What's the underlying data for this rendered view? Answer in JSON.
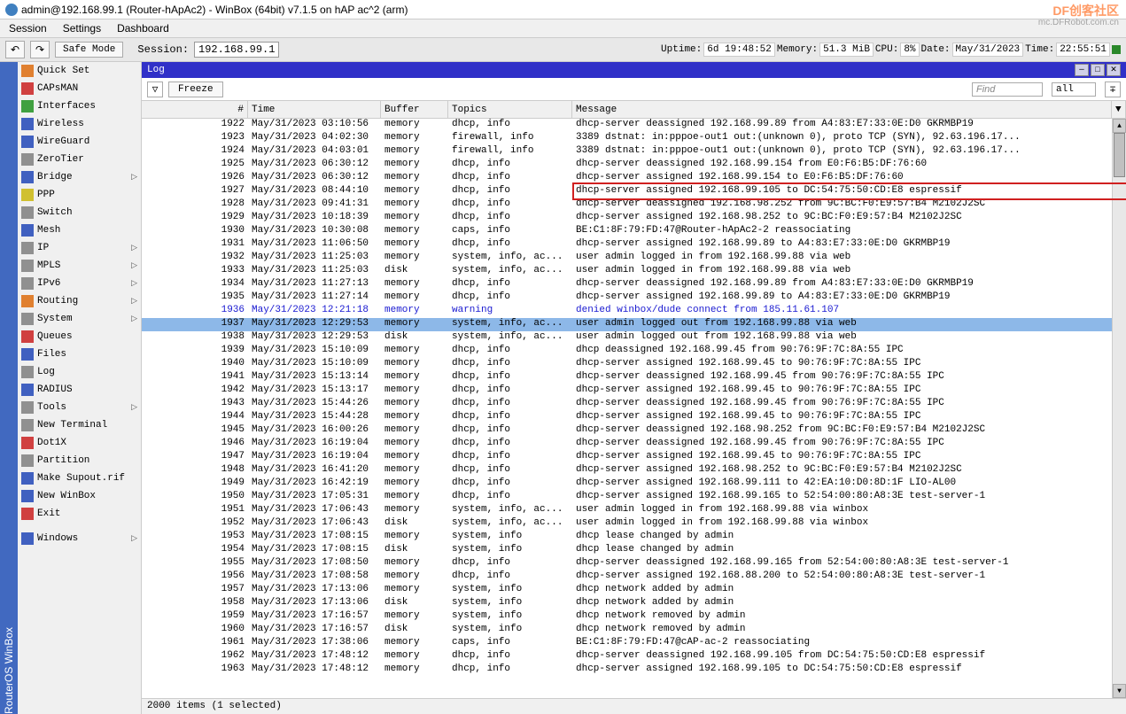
{
  "title": "admin@192.168.99.1 (Router-hApAc2) - WinBox (64bit) v7.1.5 on hAP ac^2 (arm)",
  "watermark": "DF创客社区",
  "watermark_url": "mc.DFRobot.com.cn",
  "menu": {
    "session": "Session",
    "settings": "Settings",
    "dashboard": "Dashboard"
  },
  "toolbar": {
    "safe_mode": "Safe Mode",
    "session_label": "Session:",
    "session_ip": "192.168.99.1"
  },
  "status": {
    "uptime_label": "Uptime:",
    "uptime": "6d 19:48:52",
    "memory_label": "Memory:",
    "memory": "51.3 MiB",
    "cpu_label": "CPU:",
    "cpu": "8%",
    "date_label": "Date:",
    "date": "May/31/2023",
    "time_label": "Time:",
    "time": "22:55:51"
  },
  "vertical_tab": "RouterOS WinBox",
  "sidebar": [
    {
      "label": "Quick Set",
      "ic": "ic-org"
    },
    {
      "label": "CAPsMAN",
      "ic": "ic-red"
    },
    {
      "label": "Interfaces",
      "ic": "ic-grn"
    },
    {
      "label": "Wireless",
      "ic": "ic-blu"
    },
    {
      "label": "WireGuard",
      "ic": "ic-blu"
    },
    {
      "label": "ZeroTier",
      "ic": "ic-gry"
    },
    {
      "label": "Bridge",
      "ic": "ic-blu",
      "arrow": true
    },
    {
      "label": "PPP",
      "ic": "ic-ylw"
    },
    {
      "label": "Switch",
      "ic": "ic-gry"
    },
    {
      "label": "Mesh",
      "ic": "ic-blu"
    },
    {
      "label": "IP",
      "ic": "ic-gry",
      "arrow": true
    },
    {
      "label": "MPLS",
      "ic": "ic-gry",
      "arrow": true
    },
    {
      "label": "IPv6",
      "ic": "ic-gry",
      "arrow": true
    },
    {
      "label": "Routing",
      "ic": "ic-org",
      "arrow": true
    },
    {
      "label": "System",
      "ic": "ic-gry",
      "arrow": true
    },
    {
      "label": "Queues",
      "ic": "ic-red"
    },
    {
      "label": "Files",
      "ic": "ic-blu"
    },
    {
      "label": "Log",
      "ic": "ic-gry"
    },
    {
      "label": "RADIUS",
      "ic": "ic-blu"
    },
    {
      "label": "Tools",
      "ic": "ic-gry",
      "arrow": true
    },
    {
      "label": "New Terminal",
      "ic": "ic-gry"
    },
    {
      "label": "Dot1X",
      "ic": "ic-red"
    },
    {
      "label": "Partition",
      "ic": "ic-gry"
    },
    {
      "label": "Make Supout.rif",
      "ic": "ic-blu"
    },
    {
      "label": "New WinBox",
      "ic": "ic-blu"
    },
    {
      "label": "Exit",
      "ic": "ic-red"
    },
    {
      "label": "Windows",
      "ic": "ic-blu",
      "arrow": true,
      "sep": true
    }
  ],
  "log": {
    "title": "Log",
    "freeze": "Freeze",
    "find_placeholder": "Find",
    "filter_all": "all",
    "columns": {
      "num": "#",
      "time": "Time",
      "buffer": "Buffer",
      "topics": "Topics",
      "message": "Message"
    },
    "status_bar": "2000 items (1 selected)",
    "highlighted_row_index": 5,
    "selected_row_index": 15,
    "rows": [
      {
        "n": 1922,
        "t": "May/31/2023 03:10:56",
        "b": "memory",
        "tp": "dhcp, info",
        "m": "dhcp-server deassigned 192.168.99.89 from A4:83:E7:33:0E:D0 GKRMBP19"
      },
      {
        "n": 1923,
        "t": "May/31/2023 04:02:30",
        "b": "memory",
        "tp": "firewall, info",
        "m": "3389 dstnat: in:pppoe-out1 out:(unknown 0), proto TCP (SYN), 92.63.196.17..."
      },
      {
        "n": 1924,
        "t": "May/31/2023 04:03:01",
        "b": "memory",
        "tp": "firewall, info",
        "m": "3389 dstnat: in:pppoe-out1 out:(unknown 0), proto TCP (SYN), 92.63.196.17..."
      },
      {
        "n": 1925,
        "t": "May/31/2023 06:30:12",
        "b": "memory",
        "tp": "dhcp, info",
        "m": "dhcp-server deassigned 192.168.99.154 from E0:F6:B5:DF:76:60"
      },
      {
        "n": 1926,
        "t": "May/31/2023 06:30:12",
        "b": "memory",
        "tp": "dhcp, info",
        "m": "dhcp-server assigned 192.168.99.154 to E0:F6:B5:DF:76:60"
      },
      {
        "n": 1927,
        "t": "May/31/2023 08:44:10",
        "b": "memory",
        "tp": "dhcp, info",
        "m": "dhcp-server assigned 192.168.99.105 to DC:54:75:50:CD:E8 espressif"
      },
      {
        "n": 1928,
        "t": "May/31/2023 09:41:31",
        "b": "memory",
        "tp": "dhcp, info",
        "m": "dhcp-server deassigned 192.168.98.252 from 9C:BC:F0:E9:57:B4 M2102J2SC"
      },
      {
        "n": 1929,
        "t": "May/31/2023 10:18:39",
        "b": "memory",
        "tp": "dhcp, info",
        "m": "dhcp-server assigned 192.168.98.252 to 9C:BC:F0:E9:57:B4 M2102J2SC"
      },
      {
        "n": 1930,
        "t": "May/31/2023 10:30:08",
        "b": "memory",
        "tp": "caps, info",
        "m": "BE:C1:8F:79:FD:47@Router-hApAc2-2 reassociating"
      },
      {
        "n": 1931,
        "t": "May/31/2023 11:06:50",
        "b": "memory",
        "tp": "dhcp, info",
        "m": "dhcp-server assigned 192.168.99.89 to A4:83:E7:33:0E:D0 GKRMBP19"
      },
      {
        "n": 1932,
        "t": "May/31/2023 11:25:03",
        "b": "memory",
        "tp": "system, info, ac...",
        "m": "user admin logged in from 192.168.99.88 via web"
      },
      {
        "n": 1933,
        "t": "May/31/2023 11:25:03",
        "b": "disk",
        "tp": "system, info, ac...",
        "m": "user admin logged in from 192.168.99.88 via web"
      },
      {
        "n": 1934,
        "t": "May/31/2023 11:27:13",
        "b": "memory",
        "tp": "dhcp, info",
        "m": "dhcp-server deassigned 192.168.99.89 from A4:83:E7:33:0E:D0 GKRMBP19"
      },
      {
        "n": 1935,
        "t": "May/31/2023 11:27:14",
        "b": "memory",
        "tp": "dhcp, info",
        "m": "dhcp-server assigned 192.168.99.89 to A4:83:E7:33:0E:D0 GKRMBP19"
      },
      {
        "n": 1936,
        "t": "May/31/2023 12:21:18",
        "b": "memory",
        "tp": "warning",
        "m": "denied winbox/dude connect from 185.11.61.107",
        "blue": true
      },
      {
        "n": 1937,
        "t": "May/31/2023 12:29:53",
        "b": "memory",
        "tp": "system, info, ac...",
        "m": "user admin logged out from 192.168.99.88 via web"
      },
      {
        "n": 1938,
        "t": "May/31/2023 12:29:53",
        "b": "disk",
        "tp": "system, info, ac...",
        "m": "user admin logged out from 192.168.99.88 via web"
      },
      {
        "n": 1939,
        "t": "May/31/2023 15:10:09",
        "b": "memory",
        "tp": "dhcp, info",
        "m": "dhcp deassigned 192.168.99.45 from 90:76:9F:7C:8A:55 IPC"
      },
      {
        "n": 1940,
        "t": "May/31/2023 15:10:09",
        "b": "memory",
        "tp": "dhcp, info",
        "m": "dhcp-server assigned 192.168.99.45 to 90:76:9F:7C:8A:55 IPC"
      },
      {
        "n": 1941,
        "t": "May/31/2023 15:13:14",
        "b": "memory",
        "tp": "dhcp, info",
        "m": "dhcp-server deassigned 192.168.99.45 from 90:76:9F:7C:8A:55 IPC"
      },
      {
        "n": 1942,
        "t": "May/31/2023 15:13:17",
        "b": "memory",
        "tp": "dhcp, info",
        "m": "dhcp-server assigned 192.168.99.45 to 90:76:9F:7C:8A:55 IPC"
      },
      {
        "n": 1943,
        "t": "May/31/2023 15:44:26",
        "b": "memory",
        "tp": "dhcp, info",
        "m": "dhcp-server deassigned 192.168.99.45 from 90:76:9F:7C:8A:55 IPC"
      },
      {
        "n": 1944,
        "t": "May/31/2023 15:44:28",
        "b": "memory",
        "tp": "dhcp, info",
        "m": "dhcp-server assigned 192.168.99.45 to 90:76:9F:7C:8A:55 IPC"
      },
      {
        "n": 1945,
        "t": "May/31/2023 16:00:26",
        "b": "memory",
        "tp": "dhcp, info",
        "m": "dhcp-server deassigned 192.168.98.252 from 9C:BC:F0:E9:57:B4 M2102J2SC"
      },
      {
        "n": 1946,
        "t": "May/31/2023 16:19:04",
        "b": "memory",
        "tp": "dhcp, info",
        "m": "dhcp-server deassigned 192.168.99.45 from 90:76:9F:7C:8A:55 IPC"
      },
      {
        "n": 1947,
        "t": "May/31/2023 16:19:04",
        "b": "memory",
        "tp": "dhcp, info",
        "m": "dhcp-server assigned 192.168.99.45 to 90:76:9F:7C:8A:55 IPC"
      },
      {
        "n": 1948,
        "t": "May/31/2023 16:41:20",
        "b": "memory",
        "tp": "dhcp, info",
        "m": "dhcp-server assigned 192.168.98.252 to 9C:BC:F0:E9:57:B4 M2102J2SC"
      },
      {
        "n": 1949,
        "t": "May/31/2023 16:42:19",
        "b": "memory",
        "tp": "dhcp, info",
        "m": "dhcp-server assigned 192.168.99.111 to 42:EA:10:D0:8D:1F LIO-AL00"
      },
      {
        "n": 1950,
        "t": "May/31/2023 17:05:31",
        "b": "memory",
        "tp": "dhcp, info",
        "m": "dhcp-server assigned 192.168.99.165 to 52:54:00:80:A8:3E test-server-1"
      },
      {
        "n": 1951,
        "t": "May/31/2023 17:06:43",
        "b": "memory",
        "tp": "system, info, ac...",
        "m": "user admin logged in from 192.168.99.88 via winbox"
      },
      {
        "n": 1952,
        "t": "May/31/2023 17:06:43",
        "b": "disk",
        "tp": "system, info, ac...",
        "m": "user admin logged in from 192.168.99.88 via winbox"
      },
      {
        "n": 1953,
        "t": "May/31/2023 17:08:15",
        "b": "memory",
        "tp": "system, info",
        "m": "dhcp lease changed by admin"
      },
      {
        "n": 1954,
        "t": "May/31/2023 17:08:15",
        "b": "disk",
        "tp": "system, info",
        "m": "dhcp lease changed by admin"
      },
      {
        "n": 1955,
        "t": "May/31/2023 17:08:50",
        "b": "memory",
        "tp": "dhcp, info",
        "m": "dhcp-server deassigned 192.168.99.165 from 52:54:00:80:A8:3E test-server-1"
      },
      {
        "n": 1956,
        "t": "May/31/2023 17:08:58",
        "b": "memory",
        "tp": "dhcp, info",
        "m": "dhcp-server assigned 192.168.88.200 to 52:54:00:80:A8:3E test-server-1"
      },
      {
        "n": 1957,
        "t": "May/31/2023 17:13:06",
        "b": "memory",
        "tp": "system, info",
        "m": "dhcp network added by admin"
      },
      {
        "n": 1958,
        "t": "May/31/2023 17:13:06",
        "b": "disk",
        "tp": "system, info",
        "m": "dhcp network added by admin"
      },
      {
        "n": 1959,
        "t": "May/31/2023 17:16:57",
        "b": "memory",
        "tp": "system, info",
        "m": "dhcp network removed by admin"
      },
      {
        "n": 1960,
        "t": "May/31/2023 17:16:57",
        "b": "disk",
        "tp": "system, info",
        "m": "dhcp network removed by admin"
      },
      {
        "n": 1961,
        "t": "May/31/2023 17:38:06",
        "b": "memory",
        "tp": "caps, info",
        "m": "BE:C1:8F:79:FD:47@cAP-ac-2 reassociating"
      },
      {
        "n": 1962,
        "t": "May/31/2023 17:48:12",
        "b": "memory",
        "tp": "dhcp, info",
        "m": "dhcp-server deassigned 192.168.99.105 from DC:54:75:50:CD:E8 espressif"
      },
      {
        "n": 1963,
        "t": "May/31/2023 17:48:12",
        "b": "memory",
        "tp": "dhcp, info",
        "m": "dhcp-server assigned 192.168.99.105 to DC:54:75:50:CD:E8 espressif"
      }
    ]
  }
}
